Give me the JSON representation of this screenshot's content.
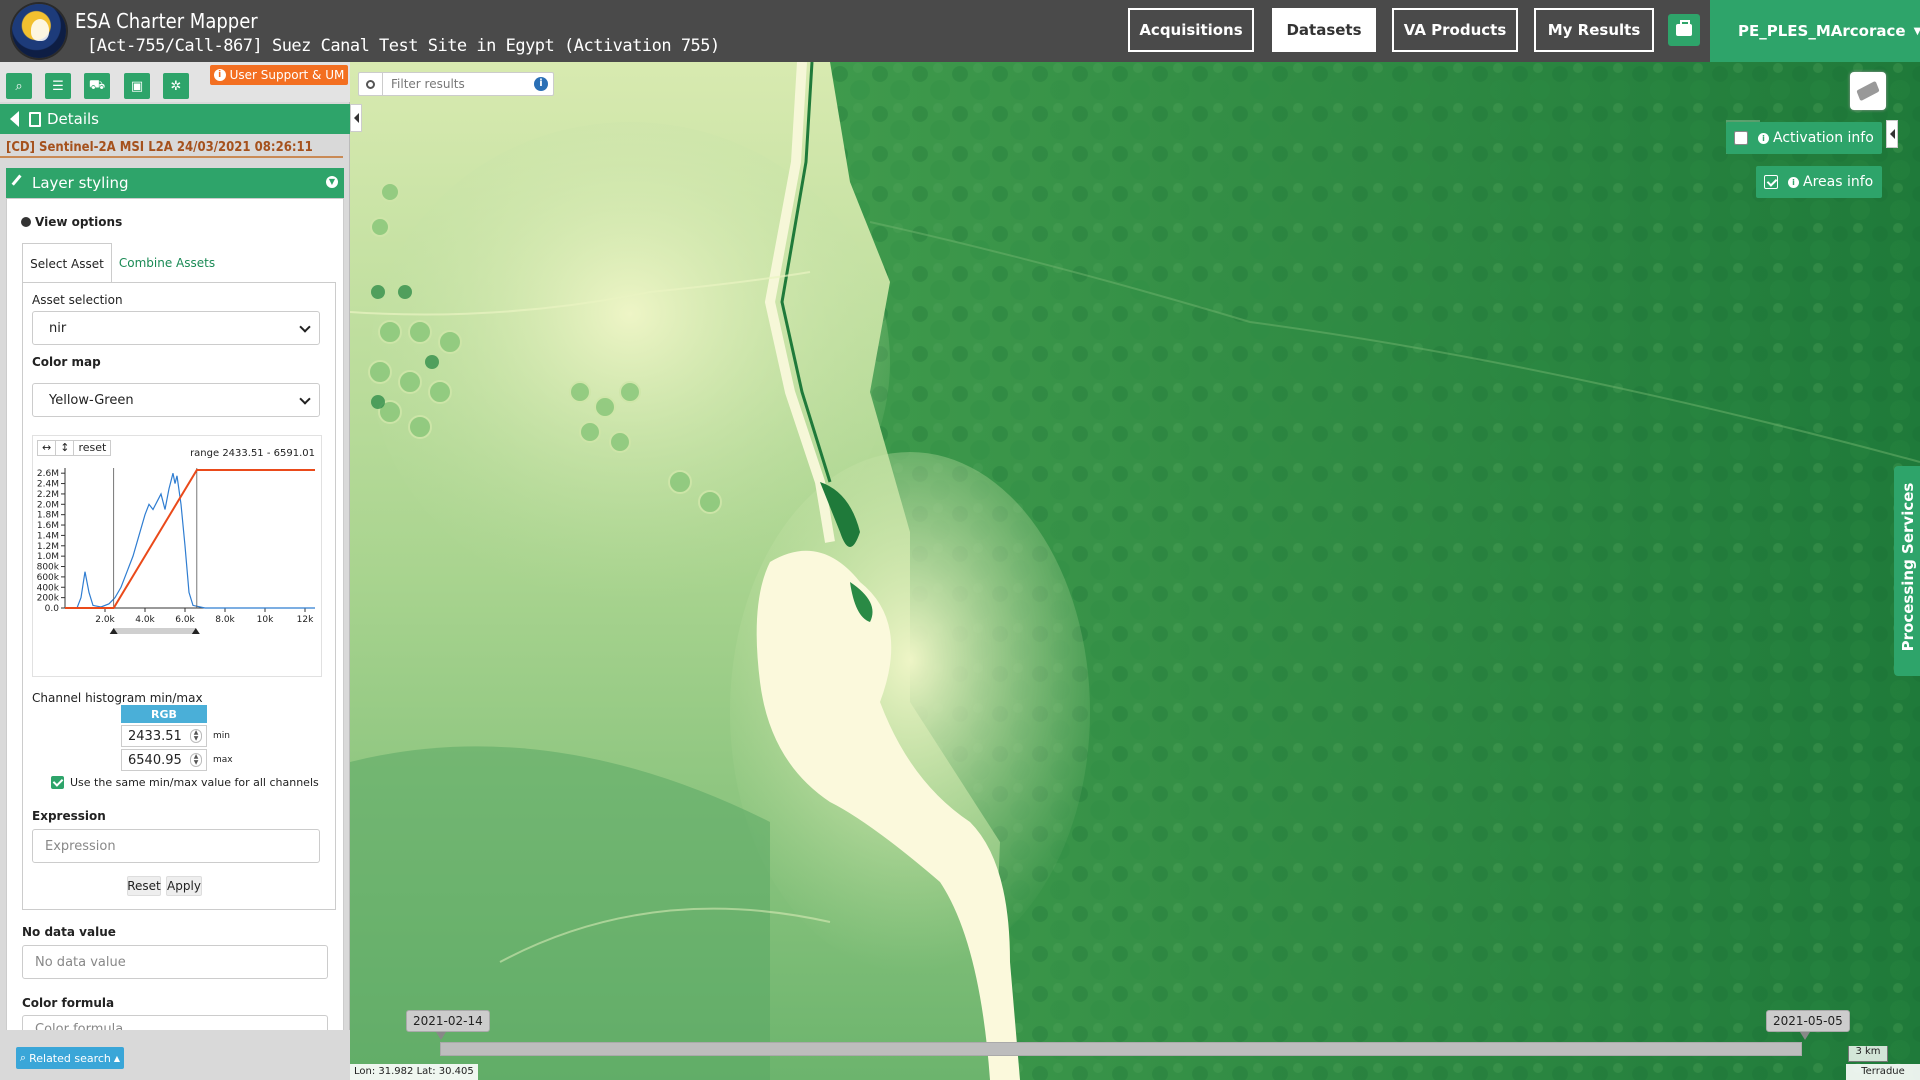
{
  "header": {
    "app_title": "ESA Charter Mapper",
    "activation_title": "[Act-755/Call-867] Suez Canal Test Site in Egypt (Activation 755)",
    "nav": [
      {
        "label": "Acquisitions",
        "active": false
      },
      {
        "label": "Datasets",
        "active": true
      },
      {
        "label": "VA Products",
        "active": false
      },
      {
        "label": "My Results",
        "active": false
      }
    ],
    "briefcase_icon": "briefcase-icon",
    "user": "PE_PLES_MArcorace"
  },
  "toolbar": {
    "tools": [
      "search-icon",
      "list-icon",
      "basket-icon",
      "archive-icon",
      "gear-icon"
    ],
    "support_label": "User Support & UM"
  },
  "details": {
    "label": "Details",
    "item_title": "[CD] Sentinel-2A MSI L2A 24/03/2021 08:26:11"
  },
  "styling": {
    "header": "Layer styling",
    "view_options": "View options",
    "tabs": [
      "Select Asset",
      "Combine Assets"
    ],
    "asset_label": "Asset selection",
    "asset_value": "nir",
    "colormap_label": "Color map",
    "colormap_value": "Yellow-Green",
    "hist_tools": [
      "↔",
      "↕",
      "reset"
    ],
    "hist_range": "range 2433.51 - 6591.01",
    "channel_label": "Channel histogram min/max",
    "rgb": "RGB",
    "min_value": "2433.51",
    "max_value": "6540.95",
    "min_suffix": "min",
    "max_suffix": "max",
    "same_minmax": "Use the same min/max value for all channels",
    "expression_label": "Expression",
    "expression_placeholder": "Expression",
    "reset": "Reset",
    "apply": "Apply",
    "nodata_label": "No data value",
    "nodata_placeholder": "No data value",
    "colorformula_label": "Color formula",
    "colorformula_placeholder": "Color formula"
  },
  "related_search": "Related search",
  "map": {
    "filter_placeholder": "Filter results",
    "activation_info": "Activation info",
    "areas_info": "Areas info",
    "processing_services": "Processing Services",
    "timeline_start": "2021-02-14",
    "timeline_end": "2021-05-05",
    "scale": "3 km",
    "coords": "Lon: 31.982 Lat: 30.405",
    "attribution": "Terradue"
  },
  "chart_data": {
    "type": "line",
    "x_ticks": [
      "2.0k",
      "4.0k",
      "6.0k",
      "8.0k",
      "10k",
      "12k"
    ],
    "y_ticks": [
      "0.0",
      "200k",
      "400k",
      "600k",
      "800k",
      "1.0M",
      "1.2M",
      "1.4M",
      "1.6M",
      "1.8M",
      "2.0M",
      "2.2M",
      "2.4M",
      "2.6M"
    ],
    "xlim": [
      0,
      12500
    ],
    "ylim": [
      0,
      2700000
    ],
    "histogram": {
      "x": [
        0,
        600,
        800,
        1000,
        1200,
        1400,
        1800,
        2200,
        2500,
        2800,
        3100,
        3400,
        3700,
        4000,
        4200,
        4400,
        4600,
        4800,
        5000,
        5200,
        5400,
        5500,
        5600,
        5800,
        6000,
        6200,
        6400,
        7000,
        12500
      ],
      "y": [
        0,
        0,
        200000,
        700000,
        300000,
        50000,
        20000,
        80000,
        200000,
        400000,
        700000,
        1000000,
        1400000,
        1800000,
        2000000,
        1900000,
        2050000,
        2200000,
        1900000,
        2300000,
        2600000,
        2400000,
        2550000,
        2000000,
        1200000,
        300000,
        50000,
        0,
        0
      ]
    },
    "stretch": {
      "min": 2433.51,
      "max": 6591.01
    },
    "handles": [
      2433.51,
      6540.95
    ]
  }
}
